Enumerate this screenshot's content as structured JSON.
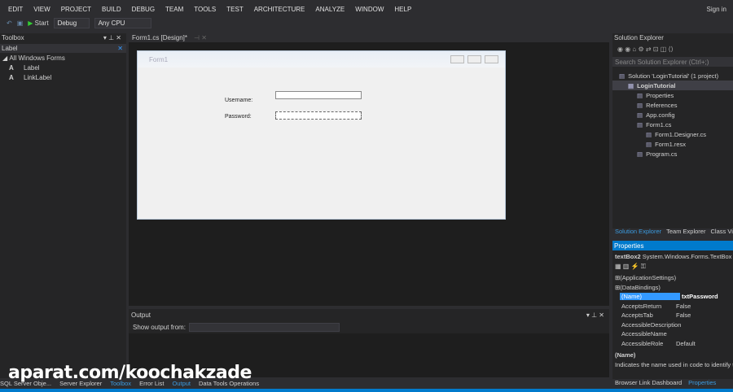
{
  "menu": [
    "EDIT",
    "VIEW",
    "PROJECT",
    "BUILD",
    "DEBUG",
    "TEAM",
    "TOOLS",
    "TEST",
    "ARCHITECTURE",
    "ANALYZE",
    "WINDOW",
    "HELP"
  ],
  "signin": "Sign in",
  "toolbar": {
    "start": "Start",
    "config": "Debug",
    "platform": "Any CPU"
  },
  "toolbox": {
    "title": "Toolbox",
    "search": "Label",
    "group": "All Windows Forms",
    "items": [
      "Label",
      "LinkLabel"
    ]
  },
  "doc_tab": "Form1.cs [Design]*",
  "form": {
    "title": "Form1",
    "username_label": "Username:",
    "password_label": "Password:"
  },
  "output": {
    "title": "Output",
    "show_from": "Show output from:"
  },
  "bottom_tabs": [
    "SQL Server Obje...",
    "Server Explorer",
    "Toolbox",
    "Error List",
    "Output",
    "Data Tools Operations"
  ],
  "watermark": "aparat.com/koochakzade",
  "solution": {
    "title": "Solution Explorer",
    "search": "Search Solution Explorer (Ctrl+;)",
    "items": [
      {
        "label": "Solution 'LoginTutorial' (1 project)",
        "indent": 0
      },
      {
        "label": "LoginTutorial",
        "indent": 1
      },
      {
        "label": "Properties",
        "indent": 2
      },
      {
        "label": "References",
        "indent": 2
      },
      {
        "label": "App.config",
        "indent": 2
      },
      {
        "label": "Form1.cs",
        "indent": 2
      },
      {
        "label": "Form1.Designer.cs",
        "indent": 3
      },
      {
        "label": "Form1.resx",
        "indent": 3
      },
      {
        "label": "Program.cs",
        "indent": 2
      }
    ]
  },
  "right_tabs": [
    "Solution Explorer",
    "Team Explorer",
    "Class View"
  ],
  "properties": {
    "title": "Properties",
    "object": "textBox2",
    "type": "System.Windows.Forms.TextBox",
    "groups": [
      "(ApplicationSettings)",
      "(DataBindings)"
    ],
    "rows": [
      {
        "name": "(Name)",
        "value": "txtPassword"
      },
      {
        "name": "AcceptsReturn",
        "value": "False"
      },
      {
        "name": "AcceptsTab",
        "value": "False"
      },
      {
        "name": "AccessibleDescription",
        "value": ""
      },
      {
        "name": "AccessibleName",
        "value": ""
      },
      {
        "name": "AccessibleRole",
        "value": "Default"
      }
    ],
    "desc_title": "(Name)",
    "desc": "Indicates the name used in code to identify the object."
  },
  "props_tabs": [
    "Browser Link Dashboard",
    "Properties"
  ],
  "accent": "#007acc"
}
